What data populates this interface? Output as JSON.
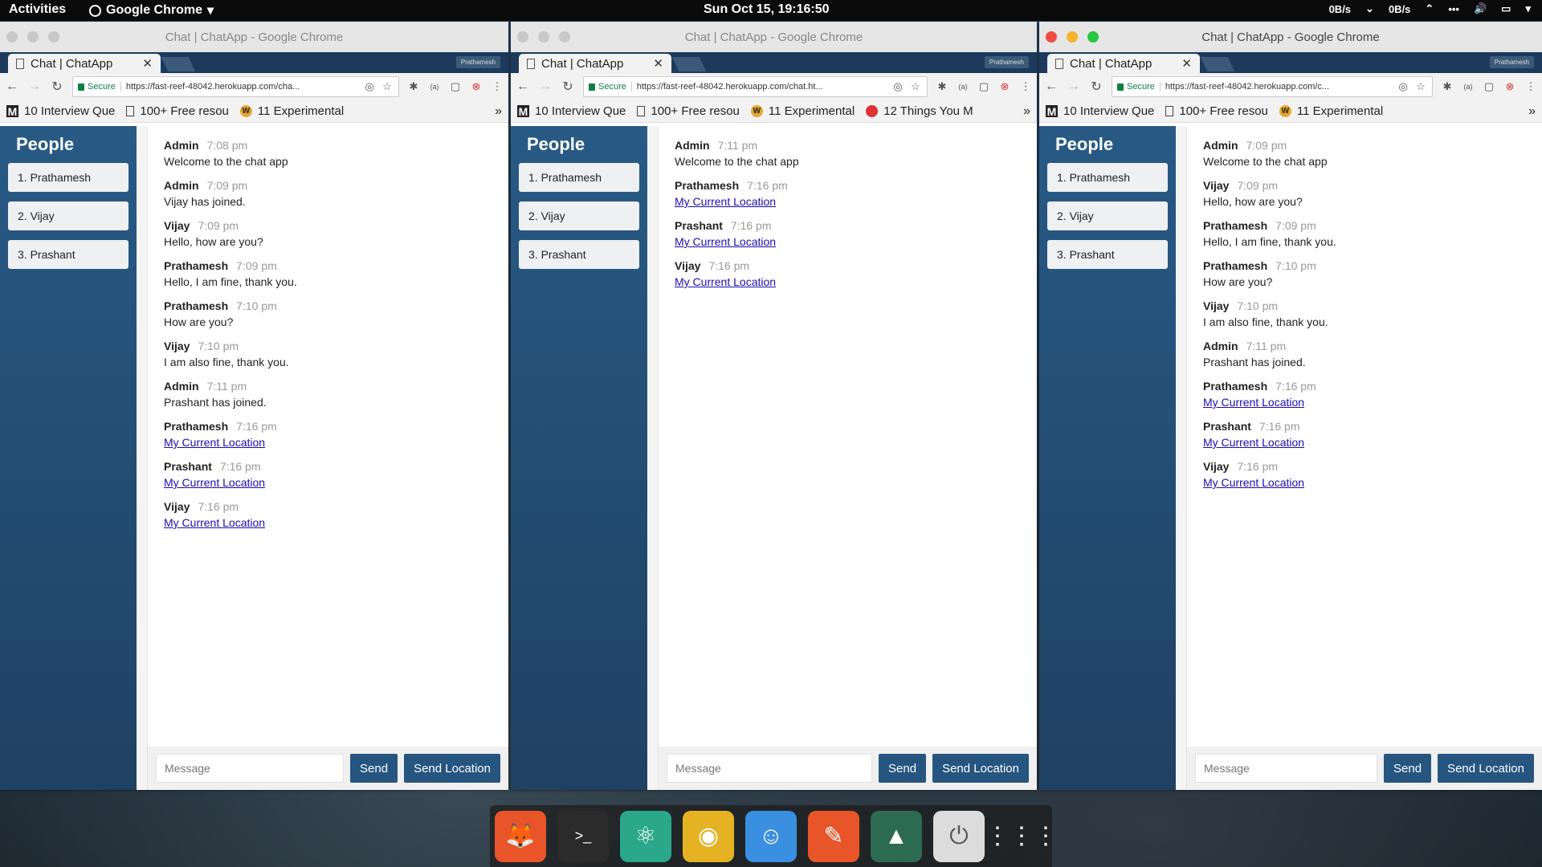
{
  "top_panel": {
    "activities": "Activities",
    "app_name": "Google Chrome",
    "clock": "Sun Oct 15, 19:16:50",
    "net_down": "0B/s",
    "net_up": "0B/s"
  },
  "windows": [
    {
      "title": "Chat | ChatApp - Google Chrome",
      "tab_label": "Chat | ChatApp",
      "profile": "Prathamesh",
      "secure": "Secure",
      "url": "https://fast-reef-48042.herokuapp.com/cha...",
      "bookmarks": [
        "10 Interview Que",
        "100+ Free resou",
        "11 Experimental"
      ],
      "people_heading": "People",
      "people": [
        "1. Prathamesh",
        "2. Vijay",
        "3. Prashant"
      ],
      "messages": [
        {
          "name": "Admin",
          "time": "7:08 pm",
          "text": "Welcome to the chat app"
        },
        {
          "name": "Admin",
          "time": "7:09 pm",
          "text": "Vijay has joined."
        },
        {
          "name": "Vijay",
          "time": "7:09 pm",
          "text": "Hello, how are you?"
        },
        {
          "name": "Prathamesh",
          "time": "7:09 pm",
          "text": "Hello, I am fine, thank you."
        },
        {
          "name": "Prathamesh",
          "time": "7:10 pm",
          "text": "How are you?"
        },
        {
          "name": "Vijay",
          "time": "7:10 pm",
          "text": "I am also fine, thank you."
        },
        {
          "name": "Admin",
          "time": "7:11 pm",
          "text": "Prashant has joined."
        },
        {
          "name": "Prathamesh",
          "time": "7:16 pm",
          "link": "My Current Location"
        },
        {
          "name": "Prashant",
          "time": "7:16 pm",
          "link": "My Current Location"
        },
        {
          "name": "Vijay",
          "time": "7:16 pm",
          "link": "My Current Location"
        }
      ],
      "placeholder": "Message",
      "send": "Send",
      "send_location": "Send Location"
    },
    {
      "title": "Chat | ChatApp - Google Chrome",
      "tab_label": "Chat | ChatApp",
      "profile": "Prathamesh",
      "secure": "Secure",
      "url": "https://fast-reef-48042.herokuapp.com/chat.ht...",
      "bookmarks": [
        "10 Interview Que",
        "100+ Free resou",
        "11 Experimental",
        "12 Things You M"
      ],
      "people_heading": "People",
      "people": [
        "1. Prathamesh",
        "2. Vijay",
        "3. Prashant"
      ],
      "messages": [
        {
          "name": "Admin",
          "time": "7:11 pm",
          "text": "Welcome to the chat app"
        },
        {
          "name": "Prathamesh",
          "time": "7:16 pm",
          "link": "My Current Location"
        },
        {
          "name": "Prashant",
          "time": "7:16 pm",
          "link": "My Current Location"
        },
        {
          "name": "Vijay",
          "time": "7:16 pm",
          "link": "My Current Location"
        }
      ],
      "placeholder": "Message",
      "send": "Send",
      "send_location": "Send Location"
    },
    {
      "title": "Chat | ChatApp - Google Chrome",
      "tab_label": "Chat | ChatApp",
      "profile": "Prathamesh",
      "secure": "Secure",
      "url": "https://fast-reef-48042.herokuapp.com/c...",
      "bookmarks": [
        "10 Interview Que",
        "100+ Free resou",
        "11 Experimental"
      ],
      "people_heading": "People",
      "people": [
        "1. Prathamesh",
        "2. Vijay",
        "3. Prashant"
      ],
      "messages": [
        {
          "name": "Admin",
          "time": "7:09 pm",
          "text": "Welcome to the chat app"
        },
        {
          "name": "Vijay",
          "time": "7:09 pm",
          "text": "Hello, how are you?"
        },
        {
          "name": "Prathamesh",
          "time": "7:09 pm",
          "text": "Hello, I am fine, thank you."
        },
        {
          "name": "Prathamesh",
          "time": "7:10 pm",
          "text": "How are you?"
        },
        {
          "name": "Vijay",
          "time": "7:10 pm",
          "text": "I am also fine, thank you."
        },
        {
          "name": "Admin",
          "time": "7:11 pm",
          "text": "Prashant has joined."
        },
        {
          "name": "Prathamesh",
          "time": "7:16 pm",
          "link": "My Current Location"
        },
        {
          "name": "Prashant",
          "time": "7:16 pm",
          "link": "My Current Location"
        },
        {
          "name": "Vijay",
          "time": "7:16 pm",
          "link": "My Current Location"
        }
      ],
      "placeholder": "Message",
      "send": "Send",
      "send_location": "Send Location"
    }
  ],
  "dock": [
    {
      "icon": "gimp-icon",
      "color": "#e8552b"
    },
    {
      "icon": "terminal-icon",
      "color": "#2b2b2b"
    },
    {
      "icon": "atom-icon",
      "color": "#2aa889"
    },
    {
      "icon": "chrome-icon",
      "color": "#e5b223"
    },
    {
      "icon": "finder-icon",
      "color": "#3a8fe0"
    },
    {
      "icon": "postman-icon",
      "color": "#e8552b"
    },
    {
      "icon": "system-monitor-icon",
      "color": "#2c6b52"
    },
    {
      "icon": "power-icon",
      "color": "#dcdcdc"
    },
    {
      "icon": "app-grid-icon",
      "color": "transparent"
    }
  ]
}
